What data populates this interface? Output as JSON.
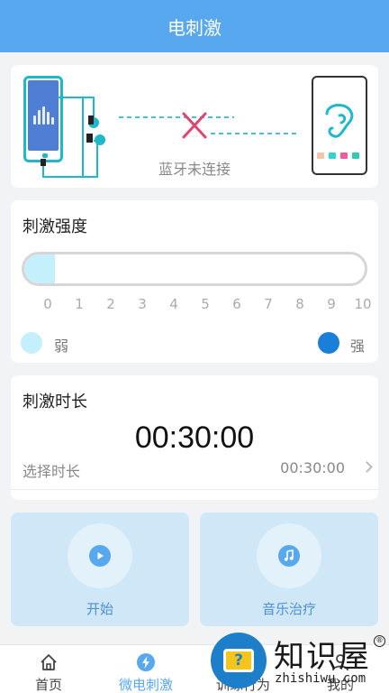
{
  "header": {
    "title": "电刺激"
  },
  "connection": {
    "status_text": "蓝牙未连接"
  },
  "intensity": {
    "title": "刺激强度",
    "value": 0,
    "max": 10,
    "scale": [
      "0",
      "1",
      "2",
      "3",
      "4",
      "5",
      "6",
      "7",
      "8",
      "9",
      "10"
    ],
    "weak_label": "弱",
    "strong_label": "强",
    "weak_color": "#c3f0fb",
    "strong_color": "#1a7fd8"
  },
  "duration": {
    "title": "刺激时长",
    "timer": "00:30:00",
    "select_label": "选择时长",
    "select_value": "00:30:00"
  },
  "actions": {
    "start_label": "开始",
    "music_label": "音乐治疗"
  },
  "nav": {
    "home_label": "首页",
    "stim_label": "微电刺激",
    "training_label": "训练行为",
    "mine_label": "我的",
    "active_color": "#58a8f0"
  },
  "watermark": {
    "title": "知识屋",
    "domain": "zhishiwu.com",
    "reg_mark": "®",
    "badge_glyph": "?"
  },
  "icons": {
    "phone_left": "phone-audio-icon",
    "disconnect": "disconnect-x-icon",
    "phone_right": "phone-ear-icon",
    "play": "play-icon",
    "music": "music-note-icon",
    "home": "home-icon",
    "bolt": "bolt-icon",
    "user": "user-icon"
  }
}
